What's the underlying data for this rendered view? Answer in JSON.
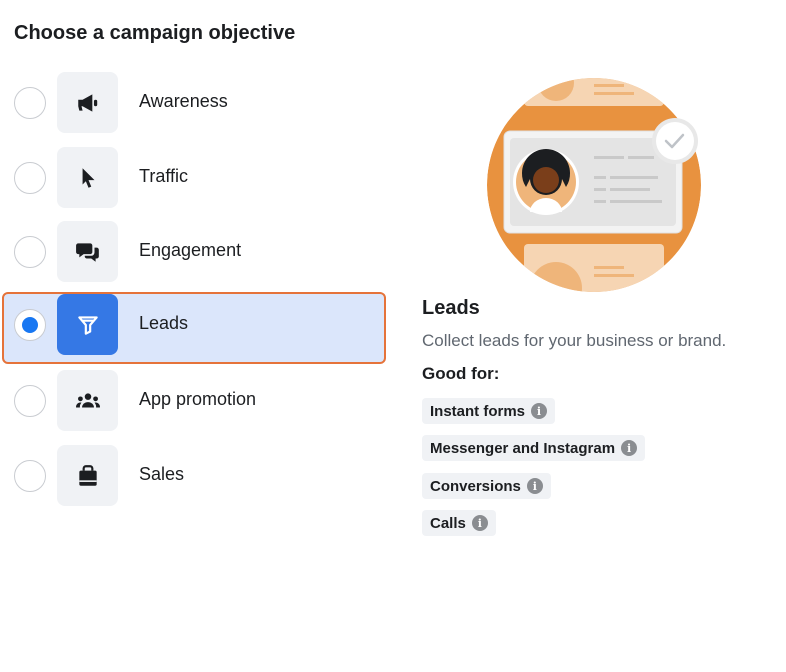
{
  "heading": "Choose a campaign objective",
  "objectives": [
    {
      "label": "Awareness",
      "icon": "megaphone-icon",
      "selected": false
    },
    {
      "label": "Traffic",
      "icon": "cursor-icon",
      "selected": false
    },
    {
      "label": "Engagement",
      "icon": "chat-bubbles-icon",
      "selected": false
    },
    {
      "label": "Leads",
      "icon": "funnel-icon",
      "selected": true
    },
    {
      "label": "App promotion",
      "icon": "people-icon",
      "selected": false
    },
    {
      "label": "Sales",
      "icon": "shopping-bag-icon",
      "selected": false
    }
  ],
  "detail": {
    "title": "Leads",
    "description": "Collect leads for your business or brand.",
    "good_for_label": "Good for:",
    "good_for": [
      {
        "label": "Instant forms",
        "icon": "info-icon"
      },
      {
        "label": "Messenger and Instagram",
        "icon": "info-icon"
      },
      {
        "label": "Conversions",
        "icon": "info-icon"
      },
      {
        "label": "Calls",
        "icon": "info-icon"
      }
    ]
  },
  "colors": {
    "selected_bg": "#dbe6fb",
    "selected_border": "#e5733a",
    "radio_dot": "#1877f2",
    "selected_tile": "#3578e5",
    "illustration_orange": "#e8923f"
  }
}
